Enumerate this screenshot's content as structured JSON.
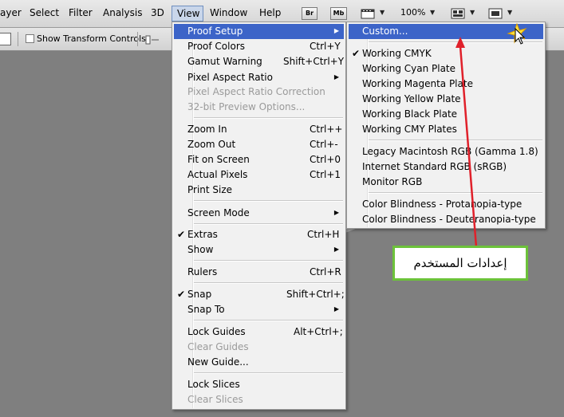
{
  "menubar": {
    "items": [
      "ayer",
      "Select",
      "Filter",
      "Analysis",
      "3D",
      "View",
      "Window",
      "Help"
    ],
    "bridge_label": "Br",
    "minibridge_label": "Mb",
    "zoom": "100%"
  },
  "options_bar": {
    "show_transform_controls": "Show Transform Controls"
  },
  "view_menu": {
    "items": [
      {
        "label": "Proof Setup",
        "shortcut": "",
        "submenu": true
      },
      {
        "label": "Proof Colors",
        "shortcut": "Ctrl+Y"
      },
      {
        "label": "Gamut Warning",
        "shortcut": "Shift+Ctrl+Y"
      },
      {
        "label": "Pixel Aspect Ratio",
        "shortcut": "",
        "submenu": true
      },
      {
        "label": "Pixel Aspect Ratio Correction",
        "shortcut": "",
        "disabled": true
      },
      {
        "label": "32-bit Preview Options...",
        "shortcut": "",
        "disabled": true
      },
      {
        "label": "Zoom In",
        "shortcut": "Ctrl++"
      },
      {
        "label": "Zoom Out",
        "shortcut": "Ctrl+-"
      },
      {
        "label": "Fit on Screen",
        "shortcut": "Ctrl+0"
      },
      {
        "label": "Actual Pixels",
        "shortcut": "Ctrl+1"
      },
      {
        "label": "Print Size",
        "shortcut": ""
      },
      {
        "label": "Screen Mode",
        "shortcut": "",
        "submenu": true
      },
      {
        "label": "Extras",
        "shortcut": "Ctrl+H",
        "checked": true
      },
      {
        "label": "Show",
        "shortcut": "",
        "submenu": true
      },
      {
        "label": "Rulers",
        "shortcut": "Ctrl+R"
      },
      {
        "label": "Snap",
        "shortcut": "Shift+Ctrl+;",
        "checked": true
      },
      {
        "label": "Snap To",
        "shortcut": "",
        "submenu": true
      },
      {
        "label": "Lock Guides",
        "shortcut": "Alt+Ctrl+;"
      },
      {
        "label": "Clear Guides",
        "shortcut": "",
        "disabled": true
      },
      {
        "label": "New Guide...",
        "shortcut": ""
      },
      {
        "label": "Lock Slices",
        "shortcut": ""
      },
      {
        "label": "Clear Slices",
        "shortcut": "",
        "disabled": true
      }
    ]
  },
  "proof_setup_menu": {
    "items": [
      {
        "label": "Custom..."
      },
      {
        "label": "Working CMYK",
        "checked": true
      },
      {
        "label": "Working Cyan Plate"
      },
      {
        "label": "Working Magenta Plate"
      },
      {
        "label": "Working Yellow Plate"
      },
      {
        "label": "Working Black Plate"
      },
      {
        "label": "Working CMY Plates"
      },
      {
        "label": "Legacy Macintosh RGB (Gamma 1.8)"
      },
      {
        "label": "Internet Standard RGB (sRGB)"
      },
      {
        "label": "Monitor RGB"
      },
      {
        "label": "Color Blindness - Protanopia-type"
      },
      {
        "label": "Color Blindness - Deuteranopia-type"
      }
    ]
  },
  "annotation": {
    "callout_text": "إعدادات المستخدم"
  },
  "colors": {
    "highlight": "#3c64c8",
    "arrow": "#e0202a",
    "callout_border": "#6cc23a"
  }
}
